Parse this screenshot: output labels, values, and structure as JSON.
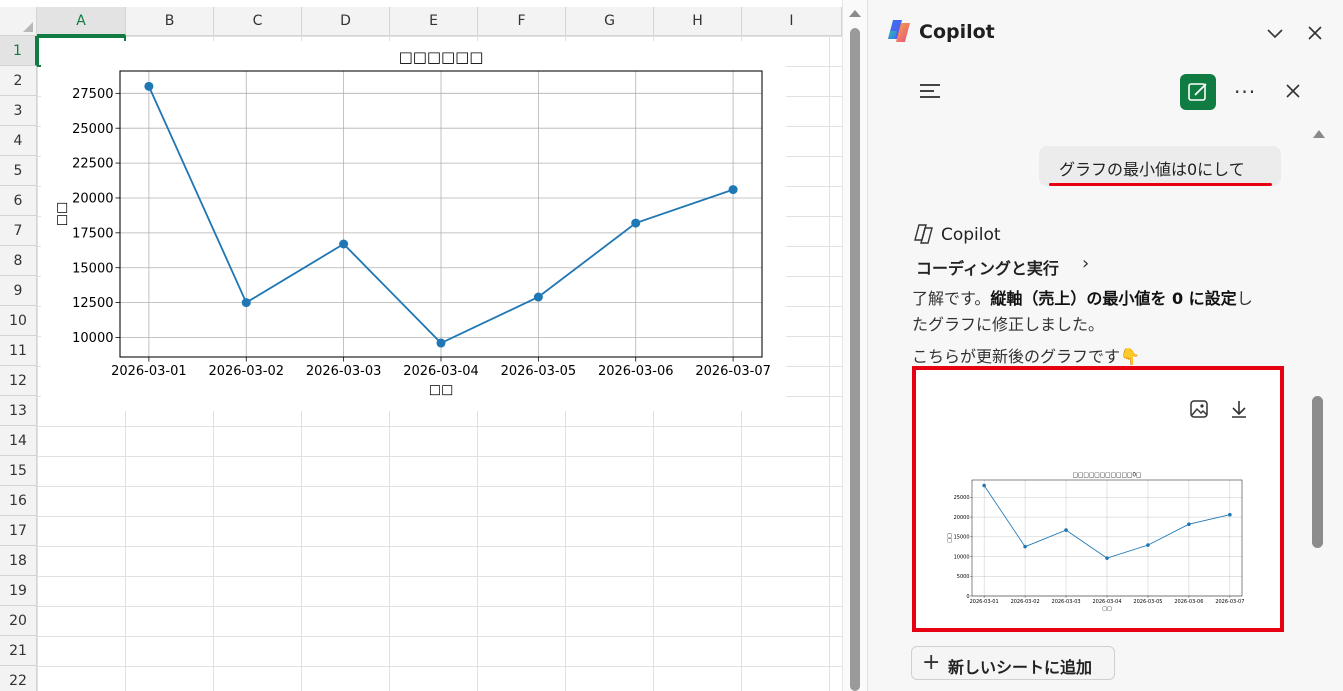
{
  "sheet": {
    "columns": [
      "A",
      "B",
      "C",
      "D",
      "E",
      "F",
      "G",
      "H",
      "I"
    ],
    "rows": [
      "1",
      "2",
      "3",
      "4",
      "5",
      "6",
      "7",
      "8",
      "9",
      "10",
      "11",
      "12",
      "13",
      "14",
      "15",
      "16",
      "17",
      "18",
      "19",
      "20",
      "21",
      "22"
    ],
    "selected_column": "A",
    "selected_row": "1"
  },
  "chart_data": [
    {
      "type": "line",
      "title": "□□□□□□",
      "xlabel": "□□",
      "ylabel": "□□",
      "x": [
        "2026-03-01",
        "2026-03-02",
        "2026-03-03",
        "2026-03-04",
        "2026-03-05",
        "2026-03-06",
        "2026-03-07"
      ],
      "series": [
        {
          "values": [
            28000,
            12500,
            16700,
            9600,
            12900,
            18200,
            20600
          ]
        }
      ],
      "yticks": [
        10000,
        12500,
        15000,
        17500,
        20000,
        22500,
        25000,
        27500
      ],
      "ylim": [
        8600,
        29100
      ],
      "grid": true,
      "color": "#1f77b4"
    },
    {
      "type": "line",
      "title": "□□□□□□□□□□□0□",
      "xlabel": "□□",
      "ylabel": "□□",
      "x": [
        "2026-03-01",
        "2026-03-02",
        "2026-03-03",
        "2026-03-04",
        "2026-03-05",
        "2026-03-06",
        "2026-03-07"
      ],
      "series": [
        {
          "values": [
            28000,
            12500,
            16700,
            9600,
            12900,
            18200,
            20600
          ]
        }
      ],
      "yticks": [
        0,
        5000,
        10000,
        15000,
        20000,
        25000
      ],
      "ylim": [
        0,
        29400
      ],
      "grid": true,
      "color": "#1f77b4"
    }
  ],
  "copilot": {
    "title": "Copilot",
    "user_message": "グラフの最小値は0にして",
    "responder": "Copilot",
    "coding_label": "コーディングと実行",
    "line1_a": "了解です。",
    "line1_b": "縦軸（売上）の最小値を 0 に設定",
    "line1_c": "し",
    "line2": "たグラフに修正しました。",
    "line3": "こちらが更新後のグラフです👇",
    "add_sheet_label": "新しいシートに追加"
  },
  "icons": {
    "header": [
      "chevron-down-icon",
      "close-icon"
    ],
    "toolbar": [
      "menu-icon",
      "new-chat-icon",
      "more-icon",
      "close-icon"
    ],
    "card": [
      "image-icon",
      "download-icon"
    ],
    "brand": "copilot-logo"
  },
  "colors": {
    "accent": "#107c41",
    "highlight": "#e60012",
    "series": "#1f77b4"
  }
}
